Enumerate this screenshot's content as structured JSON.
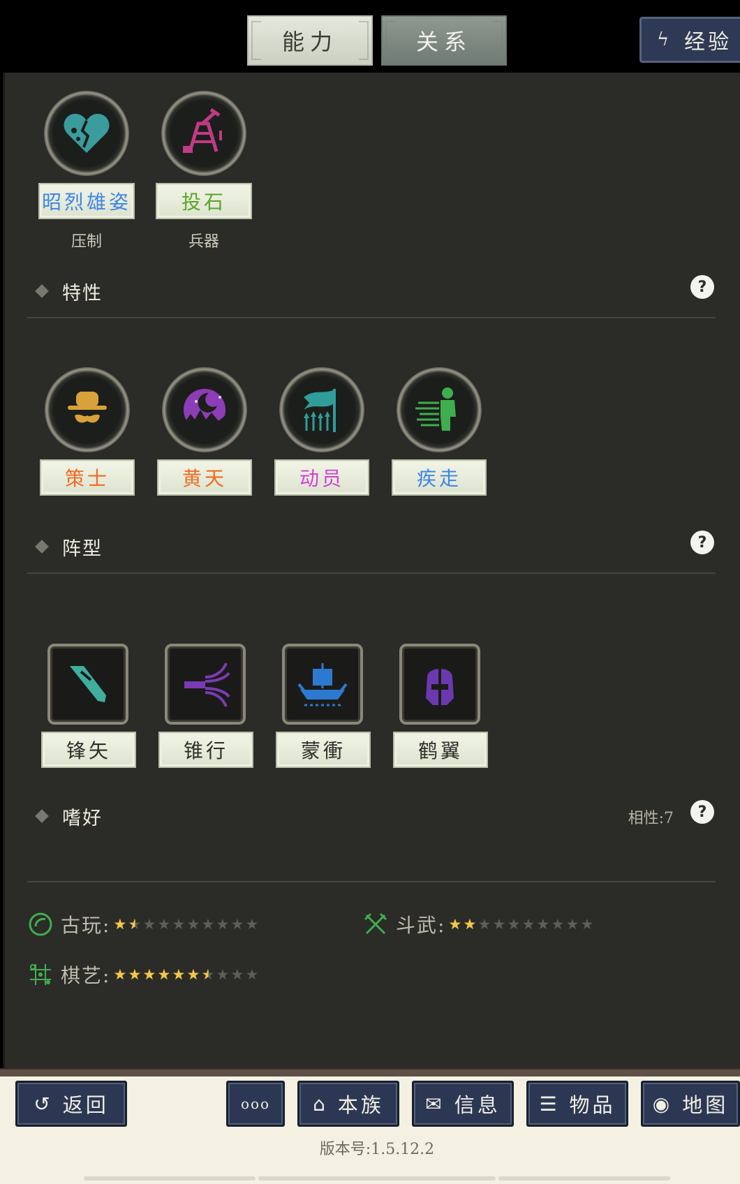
{
  "tabs": {
    "active": "能力",
    "inactive": "关系"
  },
  "exp_button": {
    "label": "经验",
    "icon": "lightning-icon"
  },
  "skills": [
    {
      "name": "昭烈雄姿",
      "sub": "压制",
      "color": "#3d86e6",
      "icon": "broken-heart-icon"
    },
    {
      "name": "投石",
      "sub": "兵器",
      "color": "#59a629",
      "icon": "catapult-icon"
    }
  ],
  "traits": {
    "title": "特性",
    "items": [
      {
        "name": "策士",
        "color": "#f06b24",
        "icon": "strategist-hat-icon"
      },
      {
        "name": "黄天",
        "color": "#f06b24",
        "icon": "moon-night-icon"
      },
      {
        "name": "动员",
        "color": "#d23fd6",
        "icon": "banner-spears-icon"
      },
      {
        "name": "疾走",
        "color": "#3d86e6",
        "icon": "running-figure-icon"
      }
    ]
  },
  "formations": {
    "title": "阵型",
    "items": [
      {
        "name": "锋矢",
        "icon": "arrowhead-formation-icon"
      },
      {
        "name": "锥行",
        "icon": "cone-formation-icon"
      },
      {
        "name": "蒙衝",
        "icon": "warship-icon"
      },
      {
        "name": "鹤翼",
        "icon": "helmet-formation-icon"
      }
    ]
  },
  "hobbies": {
    "title": "嗜好",
    "affinity": "相性:7",
    "items": [
      {
        "name": "古玩:",
        "icon": "antique-icon",
        "rating": 1.5,
        "max": 10
      },
      {
        "name": "斗武:",
        "icon": "crossed-swords-icon",
        "rating": 2,
        "max": 10
      },
      {
        "name": "棋艺:",
        "icon": "chess-board-icon",
        "rating": 6.5,
        "max": 10
      }
    ]
  },
  "bottom_nav": {
    "back": "返回",
    "more": "ooo",
    "clan": "本族",
    "info": "信息",
    "items": "物品",
    "map": "地图"
  },
  "version": "版本号:1.5.12.2"
}
